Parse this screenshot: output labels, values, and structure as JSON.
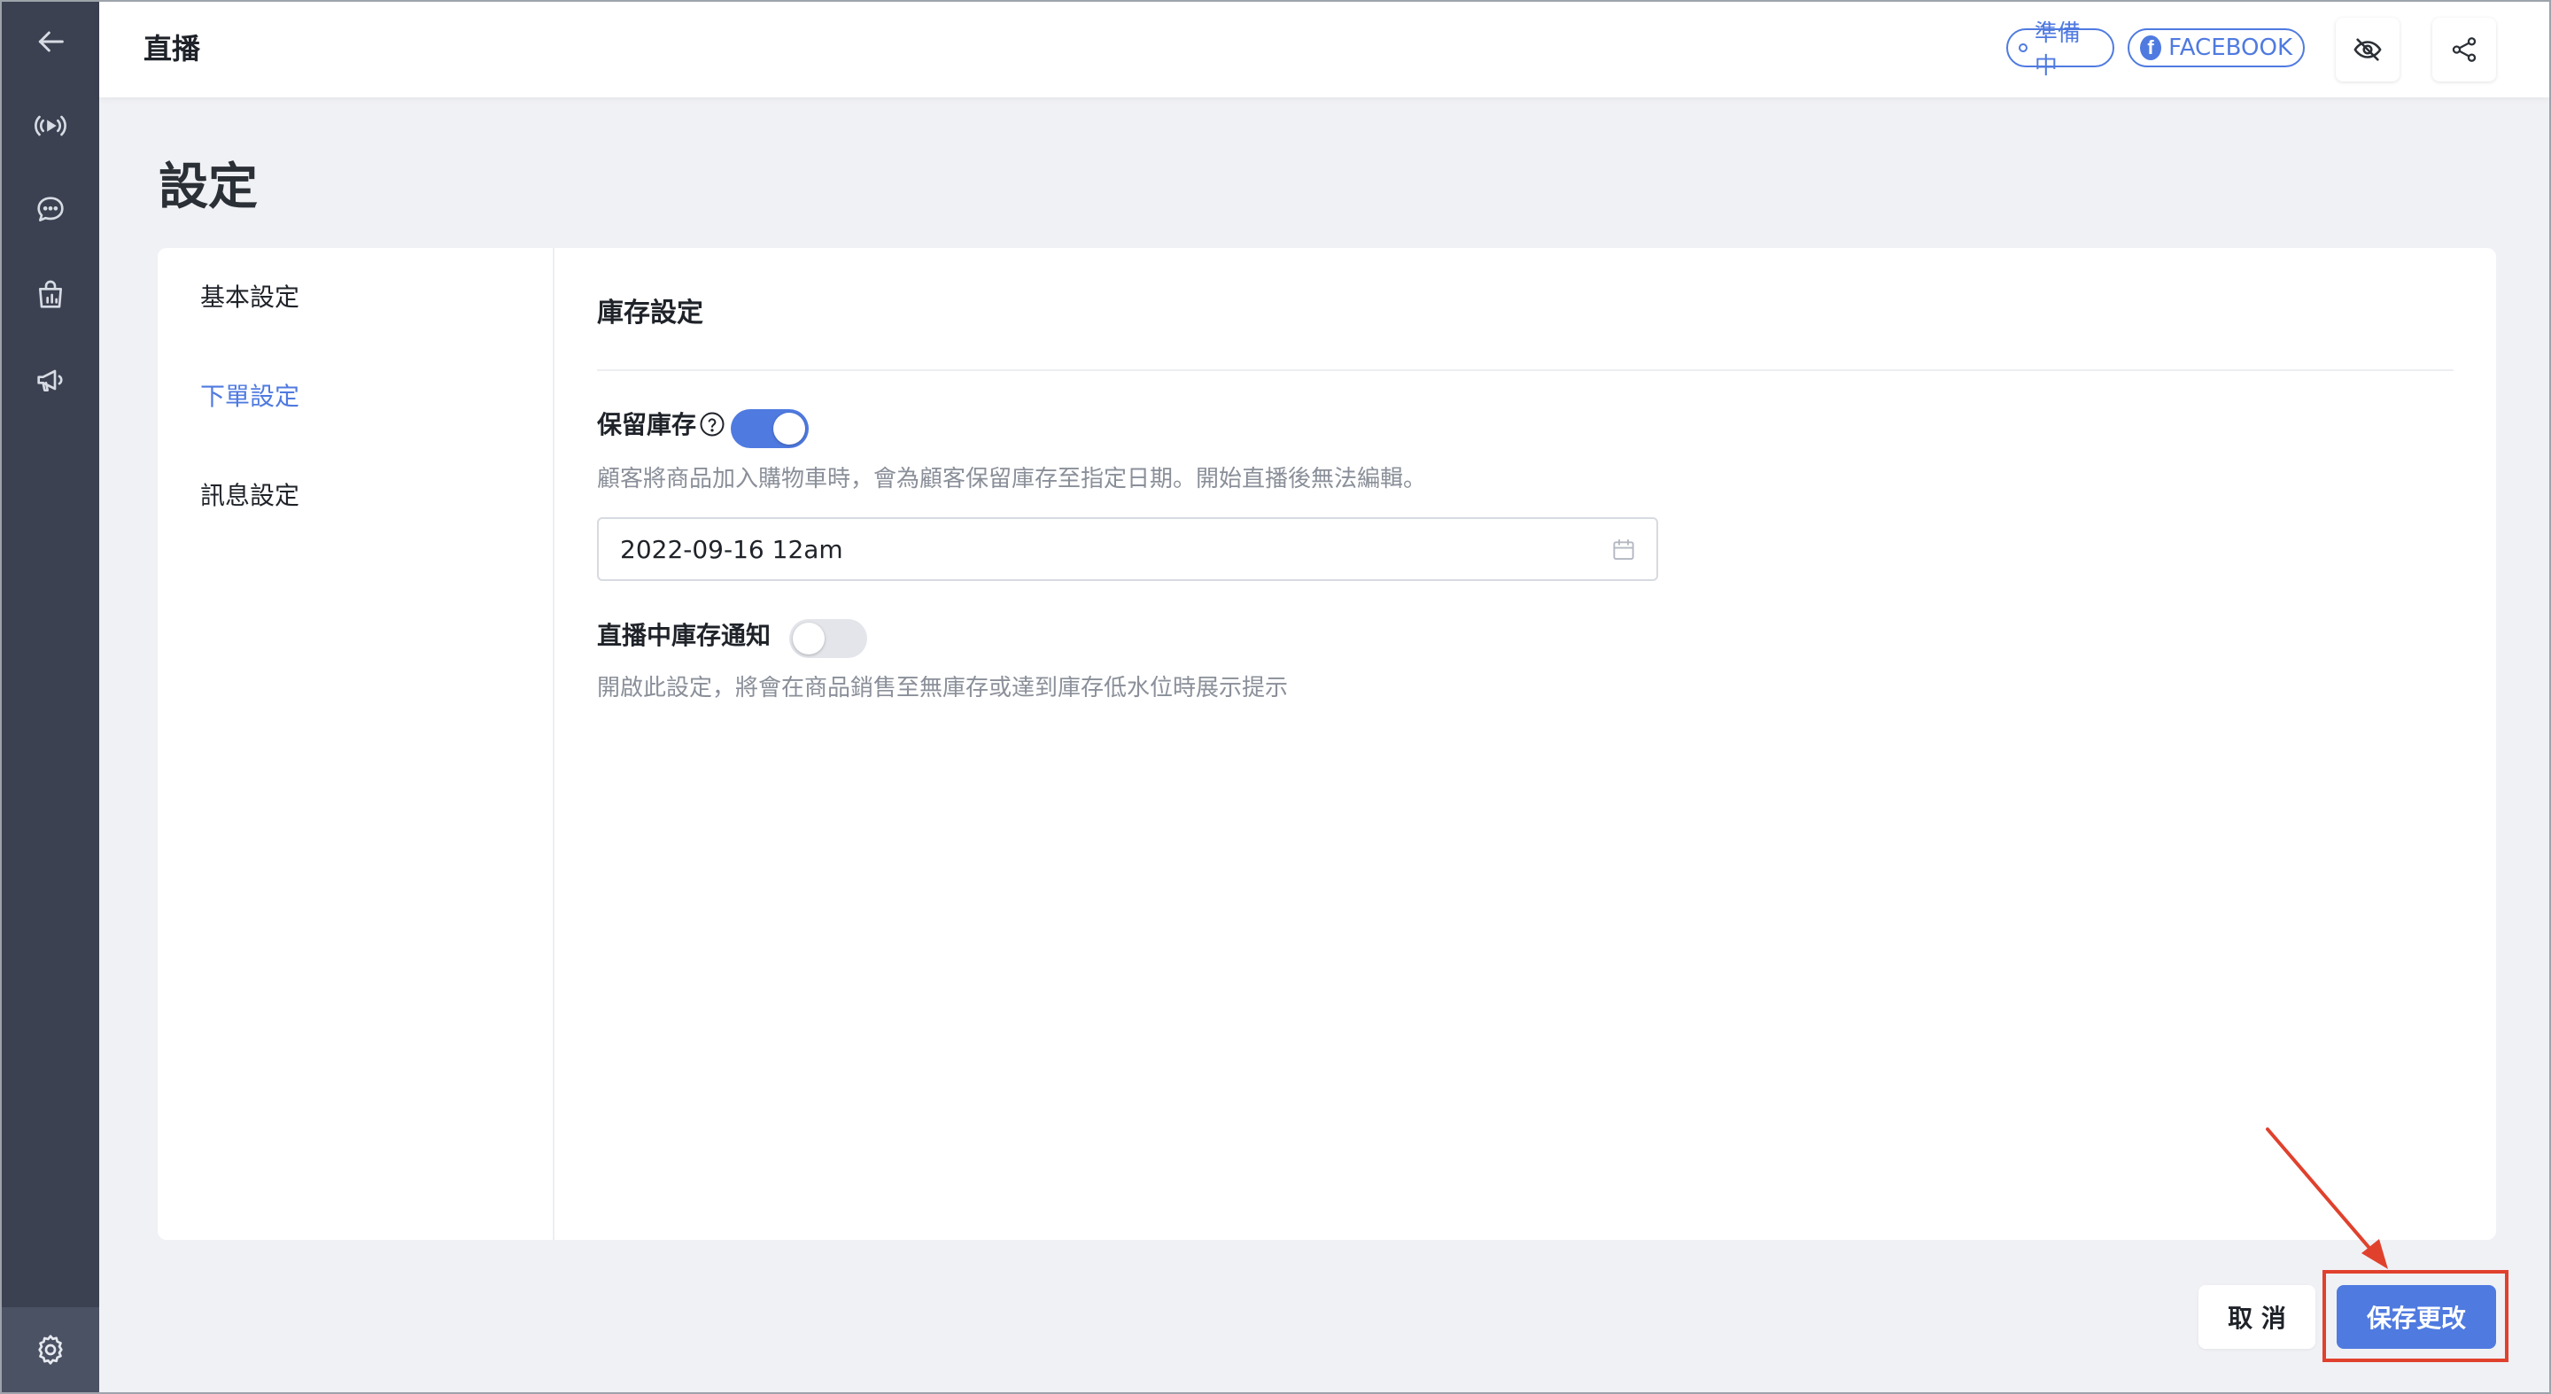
{
  "header": {
    "title": "直播",
    "status_badge": "準備中",
    "platform_badge": "FACEBOOK",
    "platform_icon_letter": "f"
  },
  "sidebar": {
    "icons": [
      "back-arrow-icon",
      "live-broadcast-icon",
      "chat-icon",
      "shopping-bag-icon",
      "megaphone-icon",
      "settings-icon"
    ],
    "active": "settings-icon"
  },
  "page": {
    "title": "設定"
  },
  "settings_nav": {
    "items": [
      {
        "label": "基本設定",
        "active": false
      },
      {
        "label": "下單設定",
        "active": true
      },
      {
        "label": "訊息設定",
        "active": false
      }
    ]
  },
  "inventory": {
    "section_title": "庫存設定",
    "reserve_stock": {
      "label": "保留庫存",
      "enabled": true,
      "description": "顧客將商品加入購物車時，會為顧客保留庫存至指定日期。開始直播後無法編輯。",
      "date_value": "2022-09-16 12am"
    },
    "live_stock_notice": {
      "label": "直播中庫存通知",
      "enabled": false,
      "description": "開啟此設定，將會在商品銷售至無庫存或達到庫存低水位時展示提示"
    }
  },
  "actions": {
    "cancel_label": "取 消",
    "save_label": "保存更改"
  },
  "colors": {
    "accent": "#4f7ae0",
    "sidebar": "#3b4151",
    "annotation": "#e0412d"
  }
}
